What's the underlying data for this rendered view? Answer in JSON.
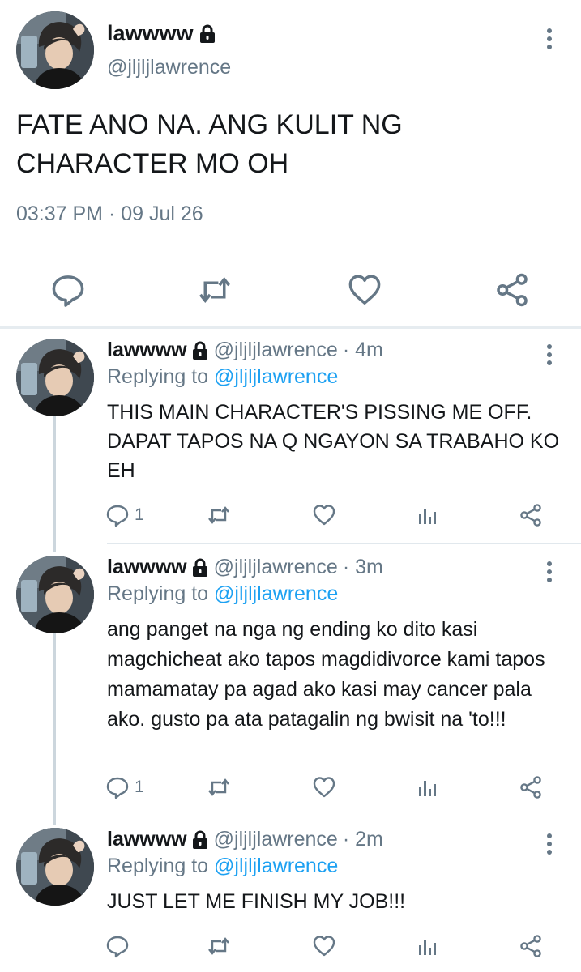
{
  "main_tweet": {
    "display_name": "lawwww",
    "handle": "@jljljlawrence",
    "text": "FATE ANO NA. ANG KULIT NG CHARACTER MO OH",
    "timestamp": "03:37 PM · 09 Jul 26",
    "icons": {
      "lock": "lock-icon",
      "more": "more-vertical-icon",
      "reply": "reply-icon",
      "retweet": "retweet-icon",
      "like": "like-icon",
      "share": "share-icon"
    }
  },
  "replies": [
    {
      "display_name": "lawwww",
      "handle": "@jljljlawrence",
      "time": "· 4m",
      "replying_prefix": "Replying to ",
      "replying_to": "@jljljlawrence",
      "text": "THIS MAIN CHARACTER'S PISSING ME OFF. DAPAT TAPOS NA Q NGAYON SA TRABAHO KO EH",
      "reply_count": "1"
    },
    {
      "display_name": "lawwww",
      "handle": "@jljljlawrence",
      "time": "· 3m",
      "replying_prefix": "Replying to ",
      "replying_to": "@jljljlawrence",
      "text": "ang panget na nga ng ending ko dito kasi magchicheat ako tapos magdidivorce kami tapos mamamatay pa agad ako kasi may cancer pala ako. gusto pa ata patagalin ng bwisit na 'to!!!",
      "reply_count": "1"
    },
    {
      "display_name": "lawwww",
      "handle": "@jljljlawrence",
      "time": "· 2m",
      "replying_prefix": "Replying to ",
      "replying_to": "@jljljlawrence",
      "text": "JUST LET ME FINISH MY JOB!!!",
      "reply_count": ""
    }
  ],
  "colors": {
    "text": "#14171a",
    "secondary": "#657786",
    "link": "#1da1f2",
    "divider": "#e1e8ed",
    "thread_line": "#ccd6dd"
  }
}
